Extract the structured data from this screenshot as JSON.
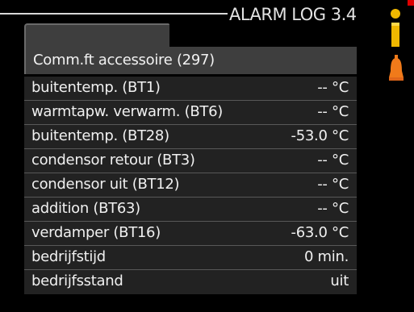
{
  "screen": {
    "title": "ALARM LOG 3.4",
    "header_label": "Comm.ft accessoire  (297)"
  },
  "rows": [
    {
      "label": "buitentemp. (BT1)",
      "value": "-- °C"
    },
    {
      "label": "warmtapw. verwarm. (BT6)",
      "value": "-- °C"
    },
    {
      "label": "buitentemp. (BT28)",
      "value": "-53.0 °C"
    },
    {
      "label": "condensor retour (BT3)",
      "value": "-- °C"
    },
    {
      "label": "condensor uit (BT12)",
      "value": "-- °C"
    },
    {
      "label": "addition (BT63)",
      "value": "-- °C"
    },
    {
      "label": "verdamper (BT16)",
      "value": "-63.0 °C"
    },
    {
      "label": "bedrijfstijd",
      "value": "0 min."
    },
    {
      "label": "bedrijfsstand",
      "value": "uit"
    }
  ],
  "icons": {
    "info": "info-icon",
    "bell": "bell-icon"
  },
  "colors": {
    "accent_yellow": "#f0b800",
    "accent_orange": "#f07a1a",
    "alarm_red": "#e00000"
  }
}
